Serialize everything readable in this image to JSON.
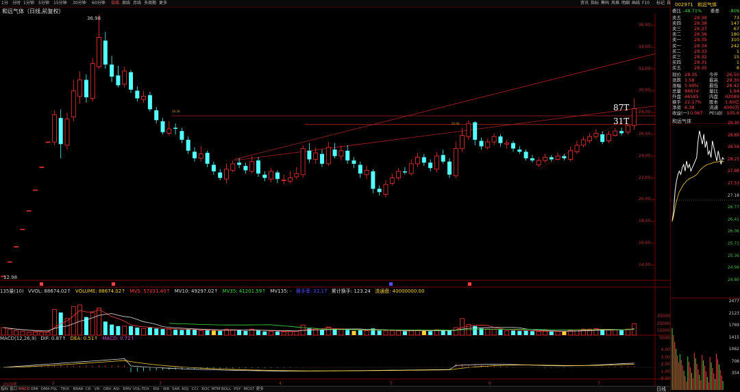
{
  "toolbar": {
    "left_items": [
      "1分",
      "分时",
      "1分钟",
      "5分钟",
      "15分钟",
      "30分钟",
      "60分钟",
      "日线",
      "周线",
      "月线",
      "多周期",
      "更多"
    ],
    "selected": "日线",
    "right_items": [
      "资讯",
      "指标",
      "筹码",
      "风格",
      "明细",
      "画线",
      "F10",
      "标记",
      "自选",
      "返回"
    ]
  },
  "chart_title": "和远气体（日线,前复权）",
  "price_axis": [
    "36.00",
    "34.00",
    "32.00",
    "30.00",
    "28.00",
    "26.00",
    "24.00",
    "22.00",
    "20.00",
    "18.00",
    "16.00",
    "14.00"
  ],
  "annotations": {
    "high_label": "36.98",
    "low_label": "12.98",
    "big_87": "87T",
    "big_31": "31T",
    "line_label_a": "28.28",
    "line_label_b": "26.90"
  },
  "x_axis_labels": [
    "2020年",
    "2",
    "3",
    "4",
    "5",
    "6",
    "7"
  ],
  "indicator": {
    "prefix": "135量(10)",
    "vvol": "VVOL: 88674.02↑",
    "volume": "VOLUME: 88674.02↑",
    "mv5": "MV5: 57031.40↑",
    "mv10": "MV10: 49297.02↑",
    "mv35": "MV35: 41201.59↑",
    "mv135": "MV135: -",
    "turnover_label": "换手率: 22.17",
    "cum": "累计换手: 123.24",
    "float": "流通盘: 40000000.00",
    "vol_axis": [
      "35000",
      "25000",
      "15000",
      "5000"
    ]
  },
  "macd": {
    "prefix": "MACD(12,26,9)",
    "dif": "DIF: 0.87↑",
    "dea": "DEA: 0.51↑",
    "macd": "MACD: 0.72↑",
    "axis": [
      "4.00",
      "3.00",
      "2.00",
      "1.00",
      "0.00"
    ]
  },
  "bottom_tabs": [
    "指标",
    "窗口",
    "MACD",
    "DMI",
    "DMA",
    "FSL",
    "TRIX",
    "BRAR",
    "CR",
    "VR",
    "OBV",
    "ASI",
    "EMV",
    "VOL-TDX",
    "RSI",
    "WR",
    "SAR",
    "KDJ",
    "CCI",
    "ROC",
    "MTM",
    "BOLL",
    "PSY",
    "MCST",
    "更多"
  ],
  "bottom_right": "日线",
  "panel": {
    "code": "002971",
    "name": "和远气体",
    "webi_label": "委比",
    "webi": "-48.71%",
    "weicha_label": "委差",
    "weicha": "-809",
    "asks": [
      {
        "label": "卖五",
        "price": "28.39",
        "vol": "73"
      },
      {
        "label": "卖四",
        "price": "28.38",
        "vol": "147"
      },
      {
        "label": "卖三",
        "price": "28.37",
        "vol": "67"
      },
      {
        "label": "卖二",
        "price": "28.36",
        "vol": "180"
      },
      {
        "label": "卖一",
        "price": "28.35",
        "vol": "310"
      }
    ],
    "bids": [
      {
        "label": "买一",
        "price": "28.34",
        "vol": "242"
      },
      {
        "label": "买二",
        "price": "28.33",
        "vol": "1"
      },
      {
        "label": "买三",
        "price": "28.32",
        "vol": "15"
      },
      {
        "label": "买四",
        "price": "28.31",
        "vol": "1"
      },
      {
        "label": "买五",
        "price": "28.30",
        "vol": "8"
      }
    ],
    "stats": [
      {
        "l1": "现价",
        "v1": "28.35",
        "l2": "今开",
        "v2": "26.50"
      },
      {
        "l1": "涨跌",
        "v1": "1.58",
        "l2": "最高",
        "v2": "29.30"
      },
      {
        "l1": "涨幅",
        "v1": "5.90%",
        "l2": "最低",
        "v2": "26.42"
      },
      {
        "l1": "总量",
        "v1": "88674",
        "l2": "量比",
        "v2": "1.94"
      },
      {
        "l1": "外盘",
        "v1": "46585",
        "l2": "内盘",
        "v2": "42089"
      },
      {
        "l1": "换手",
        "v1": "22.17%",
        "l2": "股本",
        "v2": "1.60亿"
      },
      {
        "l1": "净资",
        "v1": "6.38",
        "l2": "流通",
        "v2": "4000万"
      },
      {
        "l1": "收益(一)",
        "v1": "0.067",
        "l2": "PE(动)",
        "v2": "105.6"
      }
    ],
    "mini_title": "和远气体",
    "mini_axis": [
      "29.30",
      "28.89",
      "28.58",
      "28.23",
      "27.88",
      "27.53",
      "27.18",
      "26.77",
      "26.41",
      "26.06",
      "25.71",
      "25.36",
      "24.99",
      "24.60"
    ],
    "mini_vol_axis": [
      "2477",
      "2123",
      "1769",
      "1415",
      "1062",
      "708",
      "354"
    ]
  },
  "colors": {
    "up": "#ff3232",
    "down": "#54ffff",
    "yellow": "#ffd23a",
    "bg": "#000000"
  }
}
